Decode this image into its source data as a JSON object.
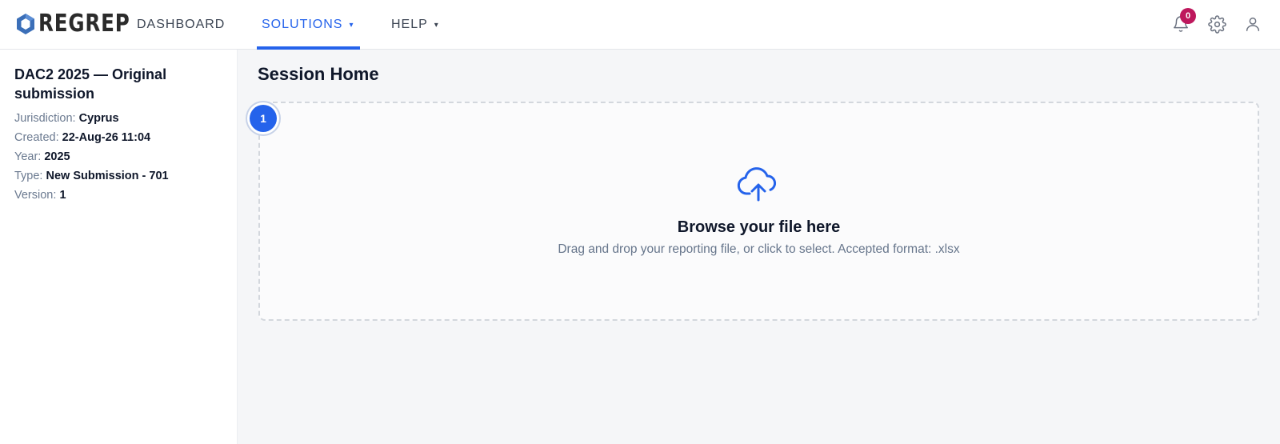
{
  "brand": {
    "name": "REGREP"
  },
  "nav": {
    "items": [
      {
        "label": "DASHBOARD",
        "caret": ""
      },
      {
        "label": "SOLUTIONS",
        "caret": "▾"
      },
      {
        "label": "HELP",
        "caret": "▾"
      }
    ],
    "active": "SOLUTIONS"
  },
  "header_icons": {
    "notifications": {
      "icon": "bell-icon",
      "count": "0"
    },
    "settings": {
      "icon": "gear-icon"
    },
    "profile": {
      "icon": "user-icon"
    }
  },
  "sidebar": {
    "title": "DAC2 2025 — Original submission",
    "fields": [
      {
        "label": "Jurisdiction:",
        "value": "Cyprus"
      },
      {
        "label": "Created:",
        "value": "22-Aug-26 11:04"
      },
      {
        "label": "Year:",
        "value": "2025"
      },
      {
        "label": "Type:",
        "value": "New Submission - 701"
      },
      {
        "label": "Version:",
        "value": "1"
      }
    ]
  },
  "main": {
    "title": "Session Home",
    "step": "1",
    "dropzone": {
      "icon": "cloud-upload-icon",
      "title": "Browse your file here",
      "subtitle": "Drag and drop your reporting file, or click to select. Accepted format: .xlsx"
    }
  },
  "colors": {
    "accent": "#2563eb",
    "badge": "#be185d",
    "text_dark": "#0f172a",
    "text_muted": "#66758b"
  }
}
